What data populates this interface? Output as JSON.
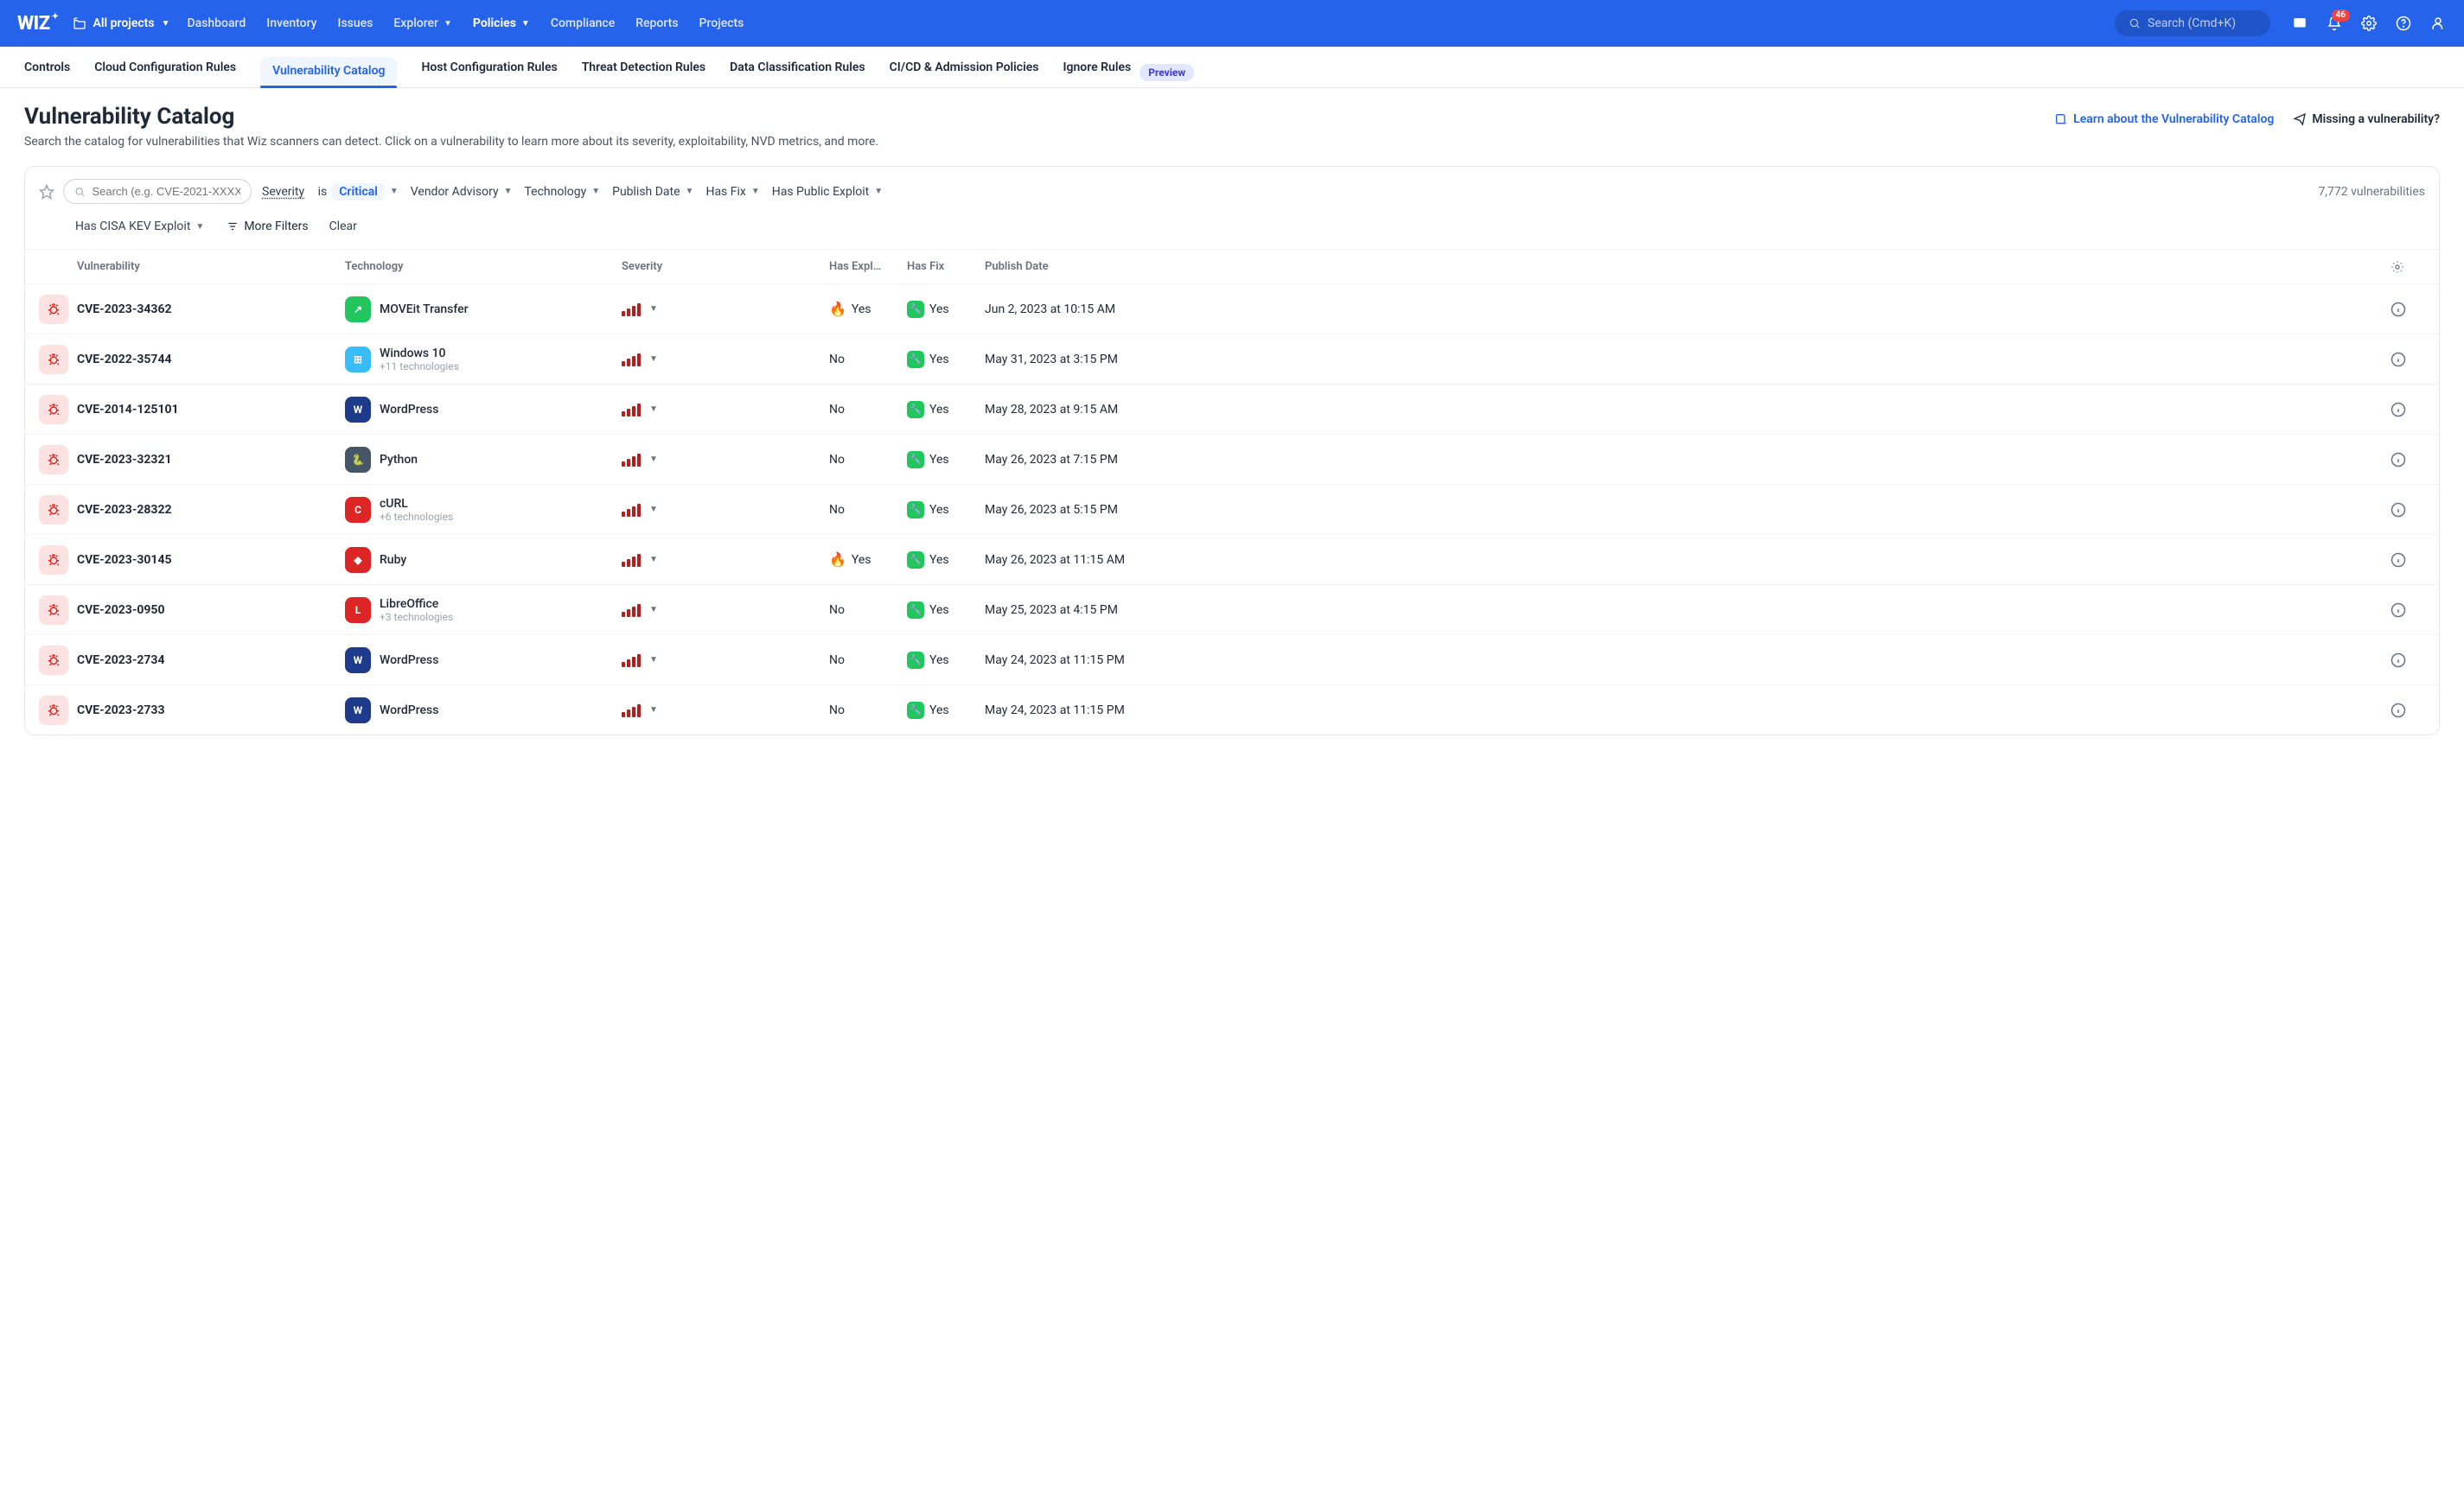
{
  "top": {
    "logo": "WIZ",
    "projects": "All projects",
    "search_placeholder": "Search (Cmd+K)",
    "badge": "46",
    "nav": [
      "Dashboard",
      "Inventory",
      "Issues",
      "Explorer",
      "Policies",
      "Compliance",
      "Reports",
      "Projects"
    ],
    "nav_active": "Policies"
  },
  "subnav": {
    "items": [
      "Controls",
      "Cloud Configuration Rules",
      "Vulnerability Catalog",
      "Host Configuration Rules",
      "Threat Detection Rules",
      "Data Classification Rules",
      "CI/CD & Admission Policies",
      "Ignore Rules"
    ],
    "active": "Vulnerability Catalog",
    "preview": "Preview"
  },
  "page": {
    "title": "Vulnerability Catalog",
    "learn": "Learn about the Vulnerability Catalog",
    "missing": "Missing a vulnerability?",
    "desc": "Search the catalog for vulnerabilities that Wiz scanners can detect. Click on a vulnerability to learn more about its severity, exploitability, NVD metrics, and more."
  },
  "filters": {
    "placeholder": "Search (e.g. CVE-2021-XXXX)",
    "sev_label": "Severity",
    "is": "is",
    "sev_val": "Critical",
    "vendor": "Vendor Advisory",
    "tech": "Technology",
    "pub": "Publish Date",
    "fix": "Has Fix",
    "pubexp": "Has Public Exploit",
    "count": "7,772 vulnerabilities",
    "cisa": "Has CISA KEV Exploit",
    "more": "More Filters",
    "clear": "Clear"
  },
  "cols": {
    "vuln": "Vulnerability",
    "tech": "Technology",
    "sev": "Severity",
    "expl": "Has Expl…",
    "fix": "Has Fix",
    "date": "Publish Date"
  },
  "common": {
    "yes": "Yes",
    "no": "No"
  },
  "rows": [
    {
      "cve": "CVE-2023-34362",
      "tech": "MOVEit Transfer",
      "sub": "",
      "color": "#22c55e",
      "letter": "↗",
      "exploit": true,
      "fix": true,
      "date": "Jun 2, 2023 at 10:15 AM"
    },
    {
      "cve": "CVE-2022-35744",
      "tech": "Windows 10",
      "sub": "+11 technologies",
      "color": "#38bdf8",
      "letter": "⊞",
      "exploit": false,
      "fix": true,
      "date": "May 31, 2023 at 3:15 PM"
    },
    {
      "cve": "CVE-2014-125101",
      "tech": "WordPress",
      "sub": "",
      "color": "#1e3a8a",
      "letter": "W",
      "exploit": false,
      "fix": true,
      "date": "May 28, 2023 at 9:15 AM"
    },
    {
      "cve": "CVE-2023-32321",
      "tech": "Python",
      "sub": "",
      "color": "#475569",
      "letter": "🐍",
      "exploit": false,
      "fix": true,
      "date": "May 26, 2023 at 7:15 PM"
    },
    {
      "cve": "CVE-2023-28322",
      "tech": "cURL",
      "sub": "+6 technologies",
      "color": "#dc2626",
      "letter": "C",
      "exploit": false,
      "fix": true,
      "date": "May 26, 2023 at 5:15 PM"
    },
    {
      "cve": "CVE-2023-30145",
      "tech": "Ruby",
      "sub": "",
      "color": "#dc2626",
      "letter": "◆",
      "exploit": true,
      "fix": true,
      "date": "May 26, 2023 at 11:15 AM"
    },
    {
      "cve": "CVE-2023-0950",
      "tech": "LibreOffice",
      "sub": "+3 technologies",
      "color": "#dc2626",
      "letter": "L",
      "exploit": false,
      "fix": true,
      "date": "May 25, 2023 at 4:15 PM"
    },
    {
      "cve": "CVE-2023-2734",
      "tech": "WordPress",
      "sub": "",
      "color": "#1e3a8a",
      "letter": "W",
      "exploit": false,
      "fix": true,
      "date": "May 24, 2023 at 11:15 PM"
    },
    {
      "cve": "CVE-2023-2733",
      "tech": "WordPress",
      "sub": "",
      "color": "#1e3a8a",
      "letter": "W",
      "exploit": false,
      "fix": true,
      "date": "May 24, 2023 at 11:15 PM"
    }
  ]
}
